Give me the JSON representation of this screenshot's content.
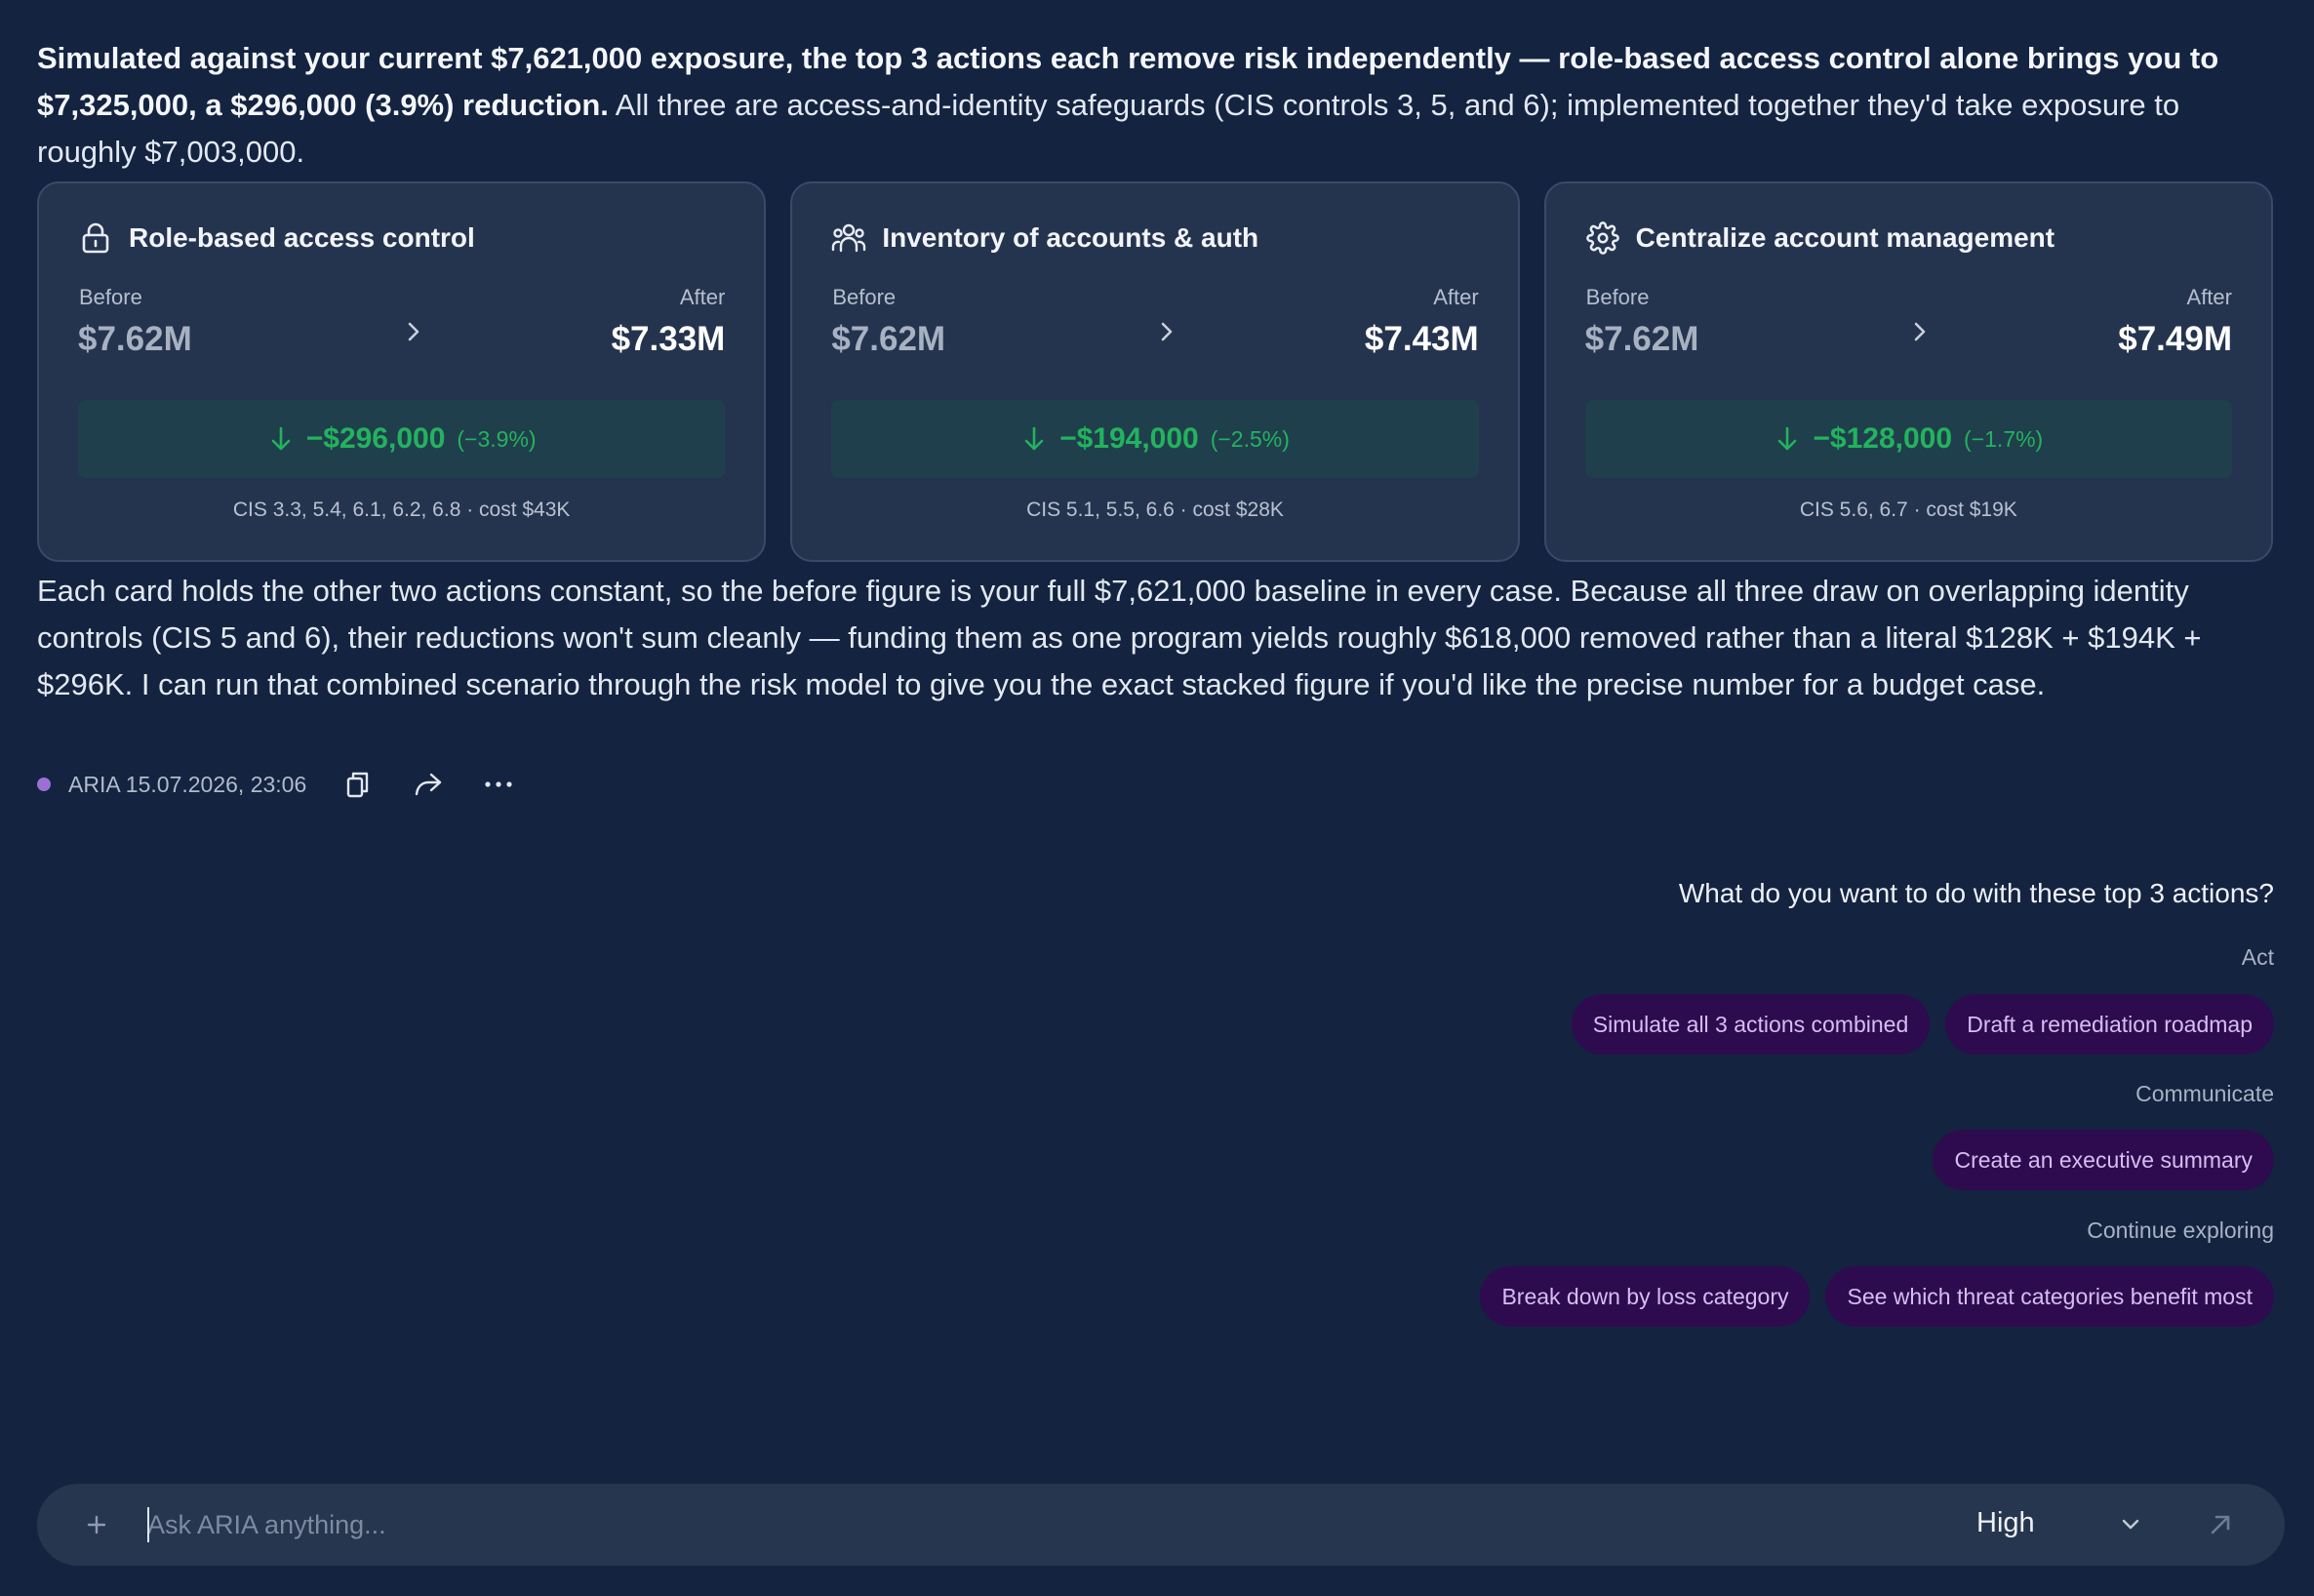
{
  "intro": {
    "bold": "Simulated against your current $7,621,000 exposure, the top 3 actions each remove risk independently — role-based access control alone brings you to $7,325,000, a $296,000 (3.9%) reduction.",
    "rest": " All three are access-and-identity safeguards (CIS controls 3, 5, and 6); implemented together they'd take exposure to roughly $7,003,000."
  },
  "cards": [
    {
      "icon": "lock-icon",
      "title": "Role-based access control",
      "before_label": "Before",
      "after_label": "After",
      "before": "$7.62M",
      "after": "$7.33M",
      "delta": "−$296,000",
      "delta_pct": "(−3.9%)",
      "footer": "CIS 3.3, 5.4, 6.1, 6.2, 6.8 · cost $43K"
    },
    {
      "icon": "users-icon",
      "title": "Inventory of accounts & auth",
      "before_label": "Before",
      "after_label": "After",
      "before": "$7.62M",
      "after": "$7.43M",
      "delta": "−$194,000",
      "delta_pct": "(−2.5%)",
      "footer": "CIS 5.1, 5.5, 6.6 · cost $28K"
    },
    {
      "icon": "gear-icon",
      "title": "Centralize account management",
      "before_label": "Before",
      "after_label": "After",
      "before": "$7.62M",
      "after": "$7.49M",
      "delta": "−$128,000",
      "delta_pct": "(−1.7%)",
      "footer": "CIS 5.6, 6.7 · cost $19K"
    }
  ],
  "body": "Each card holds the other two actions constant, so the before figure is your full $7,621,000 baseline in every case. Because all three draw on overlapping identity controls (CIS 5 and 6), their reductions won't sum cleanly — funding them as one program yields roughly $618,000 removed rather than a literal $128K + $194K + $296K. I can run that combined scenario through the risk model to give you the exact stacked figure if you'd like the precise number for a budget case.",
  "meta": {
    "stamp": "ARIA 15.07.2026, 23:06",
    "icons": [
      "copy-icon",
      "share-icon",
      "more-icon"
    ]
  },
  "suggestions": {
    "question": "What do you want to do with these top 3 actions?",
    "groups": [
      {
        "label": "Act",
        "chips": [
          "Simulate all 3 actions combined",
          "Draft a remediation roadmap"
        ]
      },
      {
        "label": "Communicate",
        "chips": [
          "Create an executive summary"
        ]
      },
      {
        "label": "Continue exploring",
        "chips": [
          "Break down by loss category",
          "See which threat categories benefit most"
        ]
      }
    ]
  },
  "composer": {
    "placeholder": "Ask ARIA anything...",
    "level": "High"
  },
  "colors": {
    "background": "#132340",
    "card": "#25344e",
    "positive": "#22b35e",
    "chip_bg": "#2e0b4e",
    "chip_text": "#d6bdf2",
    "status_dot": "#9b6fd6"
  }
}
